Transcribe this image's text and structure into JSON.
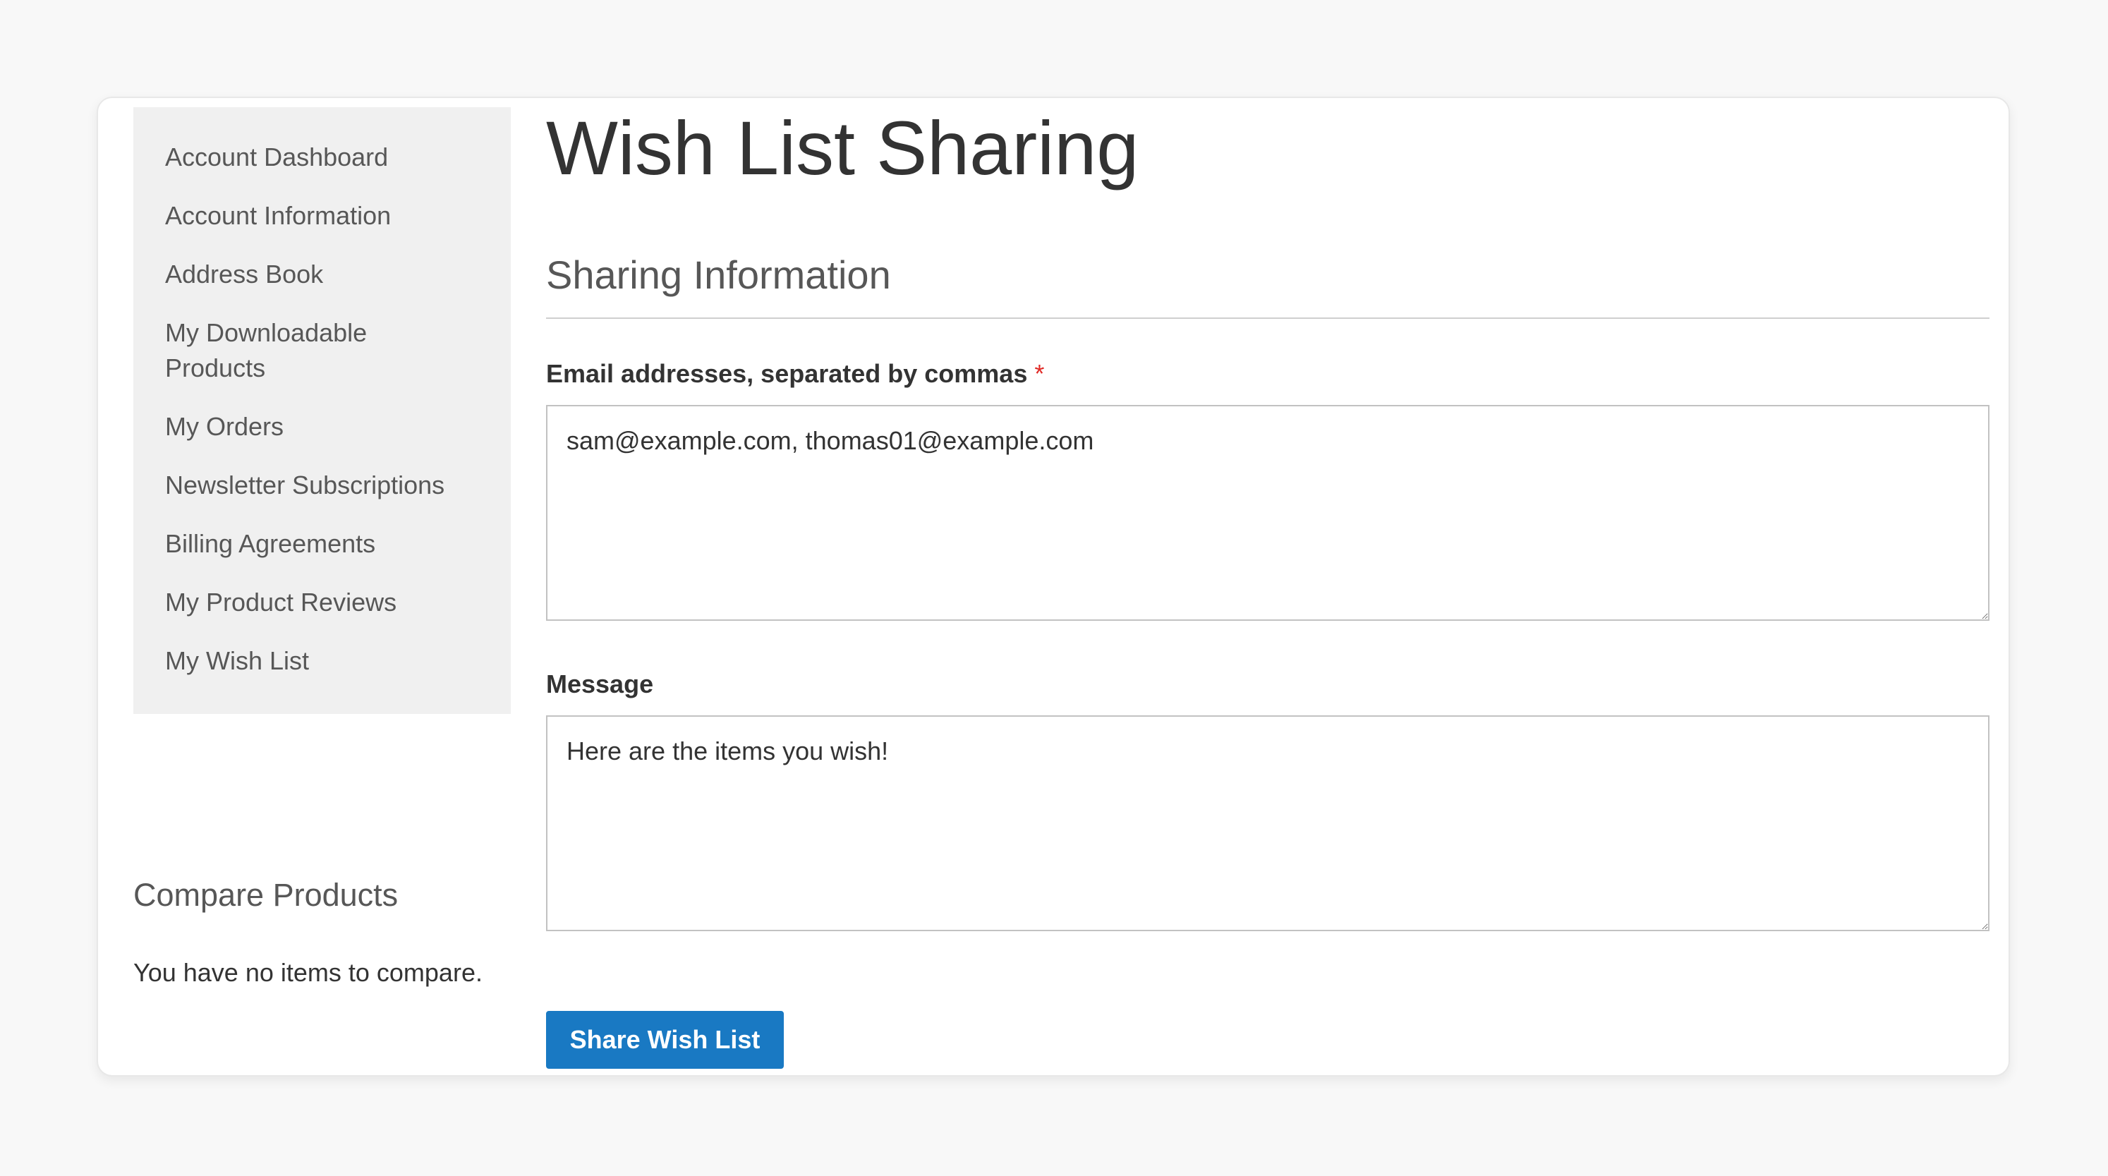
{
  "sidebar": {
    "items": [
      {
        "label": "Account Dashboard"
      },
      {
        "label": "Account Information"
      },
      {
        "label": "Address Book"
      },
      {
        "label": "My Downloadable Products"
      },
      {
        "label": "My Orders"
      },
      {
        "label": "Newsletter Subscriptions"
      },
      {
        "label": "Billing Agreements"
      },
      {
        "label": "My Product Reviews"
      },
      {
        "label": "My Wish List"
      }
    ]
  },
  "compare": {
    "title": "Compare Products",
    "empty_text": "You have no items to compare."
  },
  "main": {
    "page_title": "Wish List Sharing",
    "section_title": "Sharing Information",
    "emails": {
      "label": "Email addresses, separated by commas",
      "required_mark": "*",
      "value": "sam@example.com, thomas01@example.com"
    },
    "message": {
      "label": "Message",
      "value": "Here are the items you wish!"
    },
    "share_button_label": "Share Wish List"
  },
  "colors": {
    "page_background": "#f8f8f8",
    "sidebar_background": "#f0f0f0",
    "primary_button": "#1979c3",
    "required": "#e02b27"
  }
}
